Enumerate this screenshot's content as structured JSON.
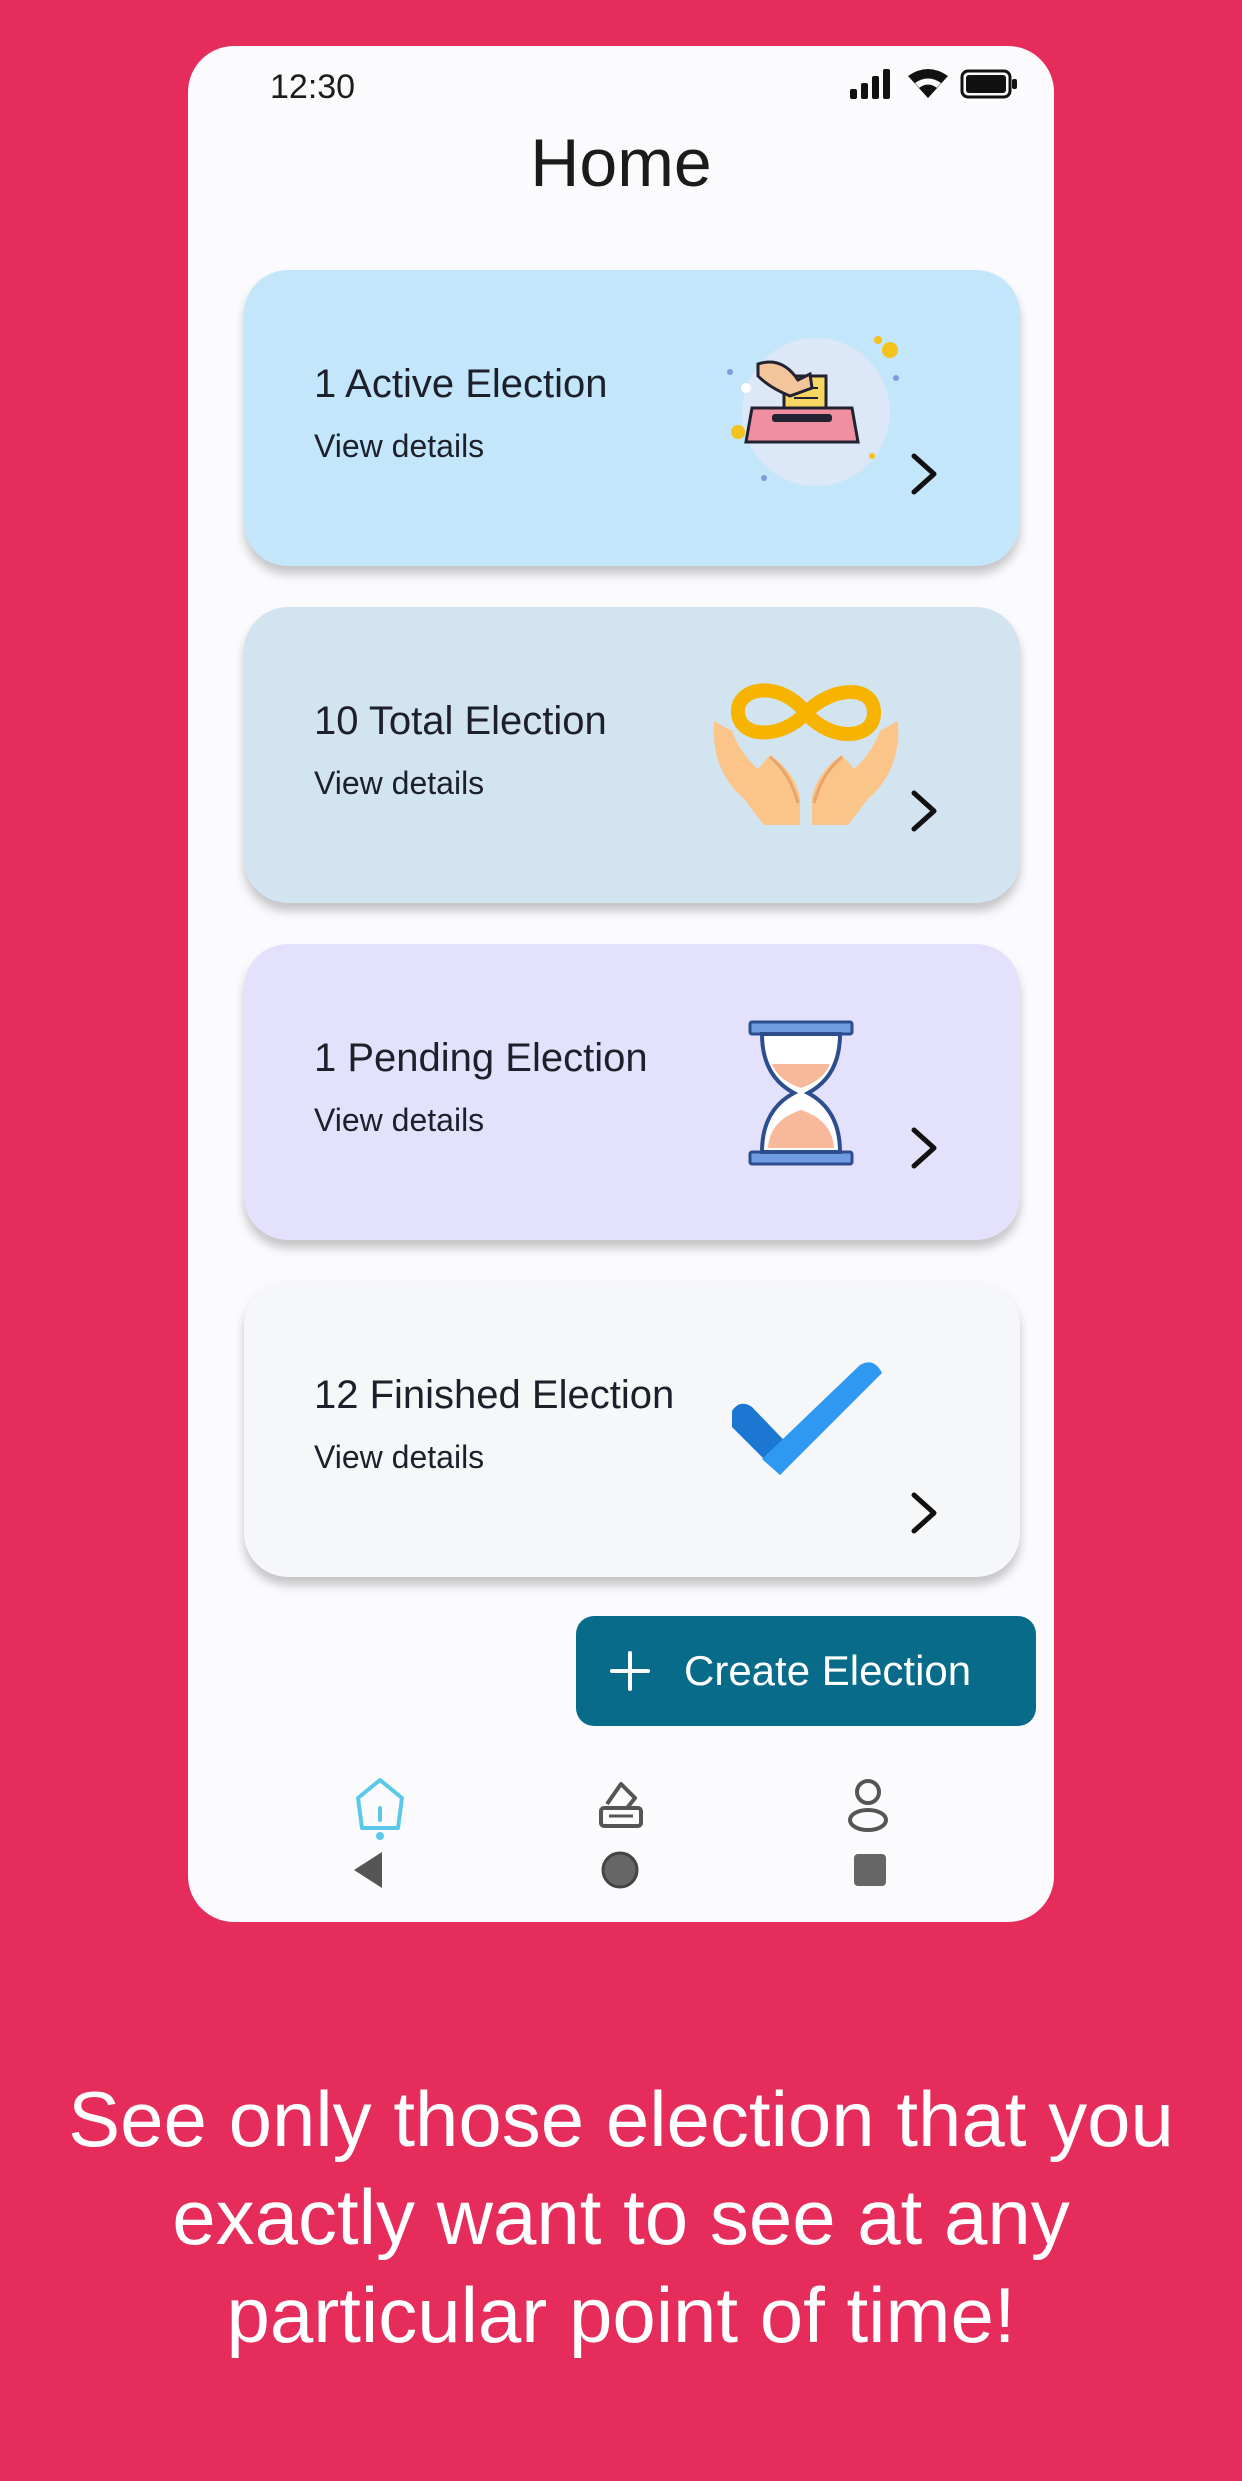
{
  "status": {
    "time": "12:30"
  },
  "header": {
    "title": "Home"
  },
  "cards": [
    {
      "title": "1 Active Election",
      "subtitle": "View details",
      "bg": "#C3E6FB",
      "icon": "ballot-box-icon"
    },
    {
      "title": "10 Total Election",
      "subtitle": "View details",
      "bg": "#D2E4F0",
      "icon": "infinity-hands-icon"
    },
    {
      "title": "1 Pending Election",
      "subtitle": "View details",
      "bg": "#E4E1FC",
      "icon": "hourglass-icon"
    },
    {
      "title": "12 Finished Election",
      "subtitle": "View details",
      "bg": "#F6F7F9",
      "icon": "checkmark-icon"
    }
  ],
  "fab": {
    "label": "Create Election"
  },
  "bottom_nav": [
    {
      "icon": "home-icon",
      "active": true
    },
    {
      "icon": "vote-icon",
      "active": false
    },
    {
      "icon": "profile-icon",
      "active": false
    }
  ],
  "system_nav": [
    "back-icon",
    "home-circle-icon",
    "recents-icon"
  ],
  "caption": {
    "text": "See only those election that you exactly want to see at any particular point of time!"
  },
  "colors": {
    "background": "#E62C5A",
    "fab": "#086B8A",
    "active_nav": "#5BC8EA"
  }
}
